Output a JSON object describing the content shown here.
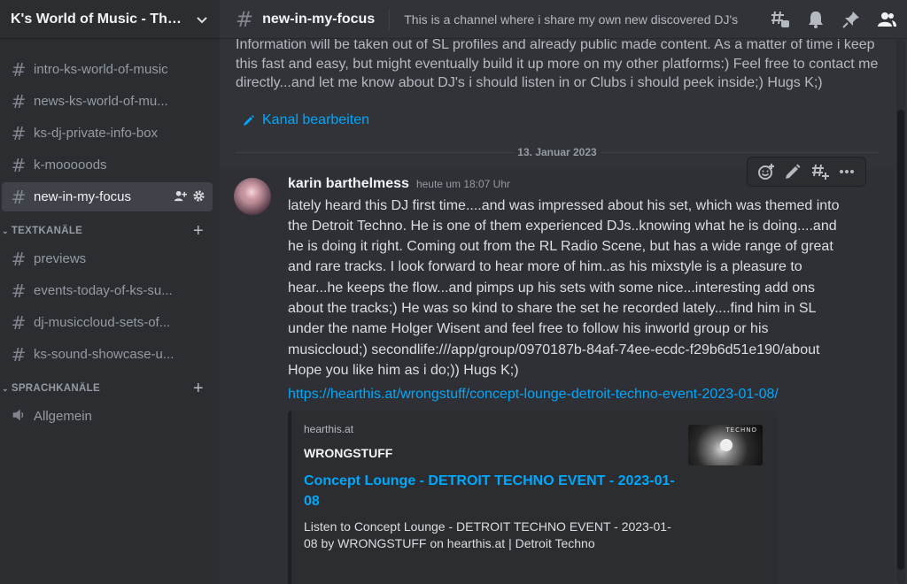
{
  "server": {
    "name": "K's World of Music - The ..."
  },
  "sidebar": {
    "channels": [
      {
        "label": "intro-ks-world-of-music"
      },
      {
        "label": "news-ks-world-of-mu..."
      },
      {
        "label": "ks-dj-private-info-box"
      },
      {
        "label": "k-mooooods"
      },
      {
        "label": "new-in-my-focus",
        "active": true
      }
    ],
    "text_category": "TEXTKANÄLE",
    "text_channels": [
      {
        "label": "previews"
      },
      {
        "label": "events-today-of-ks-su..."
      },
      {
        "label": "dj-musiccloud-sets-of..."
      },
      {
        "label": "ks-sound-showcase-u..."
      }
    ],
    "voice_category": "SPRACHKANÄLE",
    "voice_channels": [
      {
        "label": "Allgemein"
      }
    ]
  },
  "header": {
    "channel": "new-in-my-focus",
    "topic": "This is a channel where i share my own new discovered DJ's"
  },
  "intro": {
    "text": "Information will be taken out of SL profiles and already public made content. As a matter of time i keep this fast and easy, but might eventually build it up more on my other platforms:) Feel free to contact me directly...and let me know about DJ's i should listen in or Clubs i should peek inside;) Hugs K;)",
    "edit_label": "Kanal bearbeiten"
  },
  "date_divider": "13. Januar 2023",
  "message": {
    "author": "karin barthelmess",
    "timestamp": "heute um 18:07 Uhr",
    "text": "lately heard this DJ first time....and was impressed about his set, which was themed into the Detroit Techno. He is one of them experienced DJs..knowing what he is doing....and he is doing it right. Coming out from the RL Radio Scene, but has a wide range of great and rare tracks. I look forward to hear more of him..as his mixstyle is a pleasure to hear...he keeps the flow...and pimps up his sets with some nice...interesting add ons about the tracks;) He was so kind to share the set he recorded lately....find him in SL under the name Holger Wisent and feel free to follow his inworld group or his musiccloud;) secondlife:///app/group/0970187b-84af-74ee-ecdc-f29b6d51e190/about Hope you like him as i do;)) Hugs K;)",
    "link": "https://hearthis.at/wrongstuff/concept-lounge-detroit-techno-event-2023-01-08/",
    "embed": {
      "provider": "hearthis.at",
      "author": "WRONGSTUFF",
      "title": "Concept Lounge - DETROIT TECHNO EVENT - 2023-01-08",
      "description": "Listen to Concept Lounge - DETROIT TECHNO EVENT - 2023-01-08 by WRONGSTUFF on hearthis.at | Detroit Techno",
      "thumb_text": "TECHNO"
    }
  },
  "colors": {
    "link": "#00a8fc",
    "sidebar_bg": "#2b2d31",
    "main_bg": "#313338"
  }
}
